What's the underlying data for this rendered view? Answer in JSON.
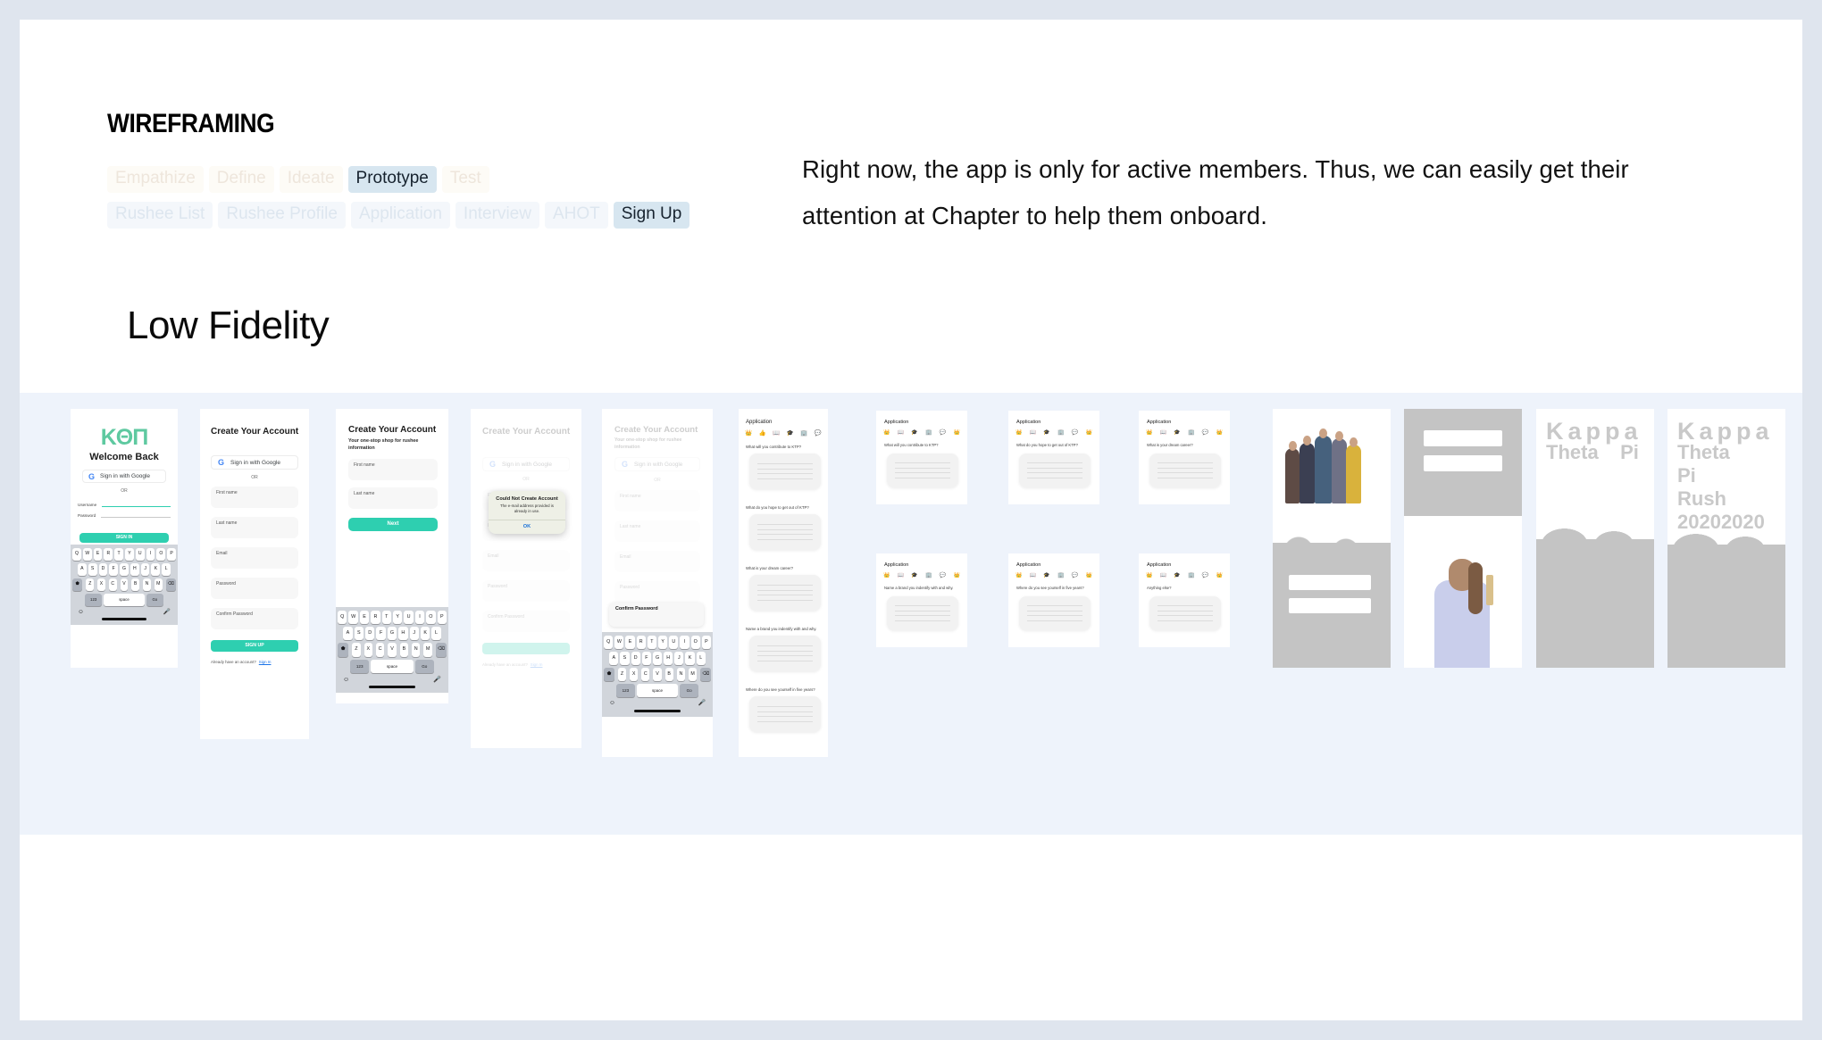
{
  "page": {
    "kicker": "WIREFRAMING",
    "section_title": "Low Fidelity",
    "blurb": "Right now, the app is only for active members. Thus, we can easily get their attention at Chapter to help them onboard."
  },
  "process_tabs": [
    {
      "label": "Empathize",
      "active": false
    },
    {
      "label": "Define",
      "active": false
    },
    {
      "label": "Ideate",
      "active": false
    },
    {
      "label": "Prototype",
      "active": true
    },
    {
      "label": "Test",
      "active": false
    }
  ],
  "screen_tabs": [
    {
      "label": "Rushee List",
      "active": false
    },
    {
      "label": "Rushee Profile",
      "active": false
    },
    {
      "label": "Application",
      "active": false
    },
    {
      "label": "Interview",
      "active": false
    },
    {
      "label": "AHOT",
      "active": false
    },
    {
      "label": "Sign Up",
      "active": true
    }
  ],
  "colors": {
    "accent_teal": "#2ecfb0",
    "active_chip": "#d7e6f0",
    "band_background": "#eef3fb",
    "frame_border": "#dfe5ee",
    "placeholder_gray": "#c4c4c4"
  },
  "mocks": {
    "signin": {
      "logo": "KΘΠ",
      "title": "Welcome Back",
      "google_button": "Sign in with Google",
      "or": "OR",
      "field_username": "Username",
      "field_password": "Password",
      "cta": "SIGN IN"
    },
    "signup_full": {
      "title": "Create Your Account",
      "google_button": "Sign in with Google",
      "or": "OR",
      "fields": [
        "First name",
        "Last name",
        "Email",
        "Password",
        "Confirm Password"
      ],
      "cta": "SIGN UP",
      "footer_text": "Already have an account?",
      "footer_link": "Sign In"
    },
    "signup_short": {
      "title": "Create Your Account",
      "subtitle": "Your one-stop shop for rushee information",
      "fields": [
        "First name",
        "Last name"
      ],
      "cta": "Next"
    },
    "error_state": {
      "title": "Create Your Account",
      "google_button": "Sign in with Google",
      "or": "OR",
      "fields": [
        "First name",
        "Last name",
        "Email",
        "Password",
        "Confirm Password"
      ],
      "footer_text": "Already have an account?",
      "footer_link": "Sign In",
      "alert_title": "Could Not Create Account",
      "alert_body": "The e-mail address provided is already in use.",
      "alert_button": "OK"
    },
    "confirm_focus": {
      "title": "Create Your Account",
      "subtitle": "Your one-stop shop for rushee information",
      "google_button": "Sign in with Google",
      "or": "OR",
      "fields": [
        "First name",
        "Last name",
        "Email",
        "Password"
      ],
      "focused_field": "Confirm Password"
    },
    "application_list": {
      "title": "Application",
      "icons": [
        "crown-icon",
        "thumbs-up-icon",
        "book-icon",
        "graduation-cap-icon",
        "building-icon",
        "speech-bubble-icon"
      ],
      "questions": [
        "What will you contribute to KTP?",
        "What do you hope to get out of KTP?",
        "What is your dream career?",
        "Name a brand you indentify with and why.",
        "Where do you see yourself in five years?"
      ]
    },
    "application_cards": [
      {
        "title": "Application",
        "question": "What will you contribute to KTP?"
      },
      {
        "title": "Application",
        "question": "What do you hope to get out of KTP?"
      },
      {
        "title": "Application",
        "question": "What is your dream career?"
      },
      {
        "title": "Application",
        "question": "Name a brand you indentify with and why."
      },
      {
        "title": "Application",
        "question": "Where do you see yourself in five years?"
      },
      {
        "title": "Application",
        "question": "Anything else?"
      }
    ],
    "branding": [
      {
        "lines": [
          "Kappa",
          "Theta    Pi"
        ]
      },
      {
        "lines": [
          "Kappa",
          "Theta",
          "Pi",
          "Rush",
          "20202020"
        ]
      }
    ]
  },
  "keyboard": {
    "row1": [
      "Q",
      "W",
      "E",
      "R",
      "T",
      "Y",
      "U",
      "I",
      "O",
      "P"
    ],
    "row2": [
      "A",
      "S",
      "D",
      "F",
      "G",
      "H",
      "J",
      "K",
      "L"
    ],
    "row3": [
      "Z",
      "X",
      "C",
      "V",
      "B",
      "N",
      "M"
    ],
    "shift": "shift-icon",
    "backspace": "backspace-icon",
    "numbers": "123",
    "space": "space",
    "go": "Go",
    "emoji": "emoji-icon",
    "mic": "microphone-icon"
  }
}
